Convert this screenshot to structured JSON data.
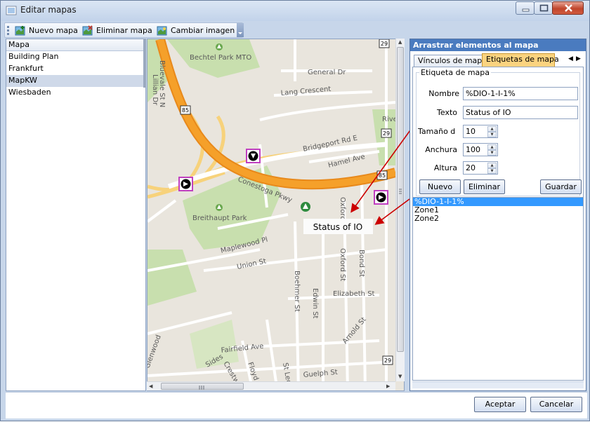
{
  "window": {
    "title": "Editar mapas"
  },
  "toolbar": {
    "new_map": "Nuevo mapa",
    "delete_map": "Eliminar mapa",
    "change_image": "Cambiar imagen"
  },
  "map_list": {
    "header": "Mapa",
    "items": [
      "Building Plan",
      "Frankfurt",
      "MapKW",
      "Wiesbaden"
    ],
    "selected": "MapKW"
  },
  "map": {
    "places": {
      "bechtel_park": "Bechtel Park MTO",
      "breithaupt_park": "Breithaupt Park",
      "river": "River"
    },
    "roads": {
      "lillian": "Lillian Dr",
      "bluevale": "Bluevale St N",
      "general": "General Dr",
      "lang": "Lang Crescent",
      "bridgeport": "Bridgeport Rd E",
      "hamel": "Hamel Ave",
      "conestoga": "Conestoga Pkwy",
      "maplewood": "Maplewood Pl",
      "union": "Union St",
      "oxford1": "Oxford St",
      "oxford2": "Oxford St",
      "bond": "Bond St",
      "boehmer": "Boehmer St",
      "edwin": "Edwin St",
      "elizabeth": "Elizabeth St",
      "arnold": "Arnold St",
      "fairfield": "Fairfield Ave",
      "crestwood": "Crestwood",
      "floyd": "Floyd St",
      "st_leger": "St Leger",
      "guelph": "Guelph St",
      "glenwood": "Glenwood",
      "sides": "Sides"
    },
    "shields": {
      "route85a": "85",
      "route85b": "85",
      "route29a": "29",
      "route29b": "29",
      "route29c": "29"
    },
    "map_label_text": "Status of IO"
  },
  "right_panel": {
    "title": "Arrastrar elementos al mapa",
    "tabs": [
      "Vínculos de mapa",
      "Etiquetas de mapa"
    ],
    "active_tab": "Etiquetas de mapa",
    "group_title": "Etiqueta de mapa",
    "fields": {
      "nombre_label": "Nombre",
      "nombre_value": "%DIO-1-I-1%",
      "texto_label": "Texto",
      "texto_value": "Status of IO",
      "tamano_label": "Tamaño  d",
      "tamano_value": "10",
      "anchura_label": "Anchura",
      "anchura_value": "100",
      "altura_label": "Altura",
      "altura_value": "20"
    },
    "buttons": {
      "nuevo": "Nuevo",
      "eliminar": "Eliminar",
      "guardar": "Guardar"
    },
    "labels": [
      "%DIO-1-I-1%",
      "Zone1",
      "Zone2"
    ],
    "selected_label": "%DIO-1-I-1%"
  },
  "footer": {
    "accept": "Aceptar",
    "cancel": "Cancelar"
  },
  "colors": {
    "highway": "#f5a02a",
    "park": "#c8dfae",
    "selection": "#3399ff",
    "active_tab": "#fbd37f",
    "annotation_arrow": "#cc0000"
  }
}
